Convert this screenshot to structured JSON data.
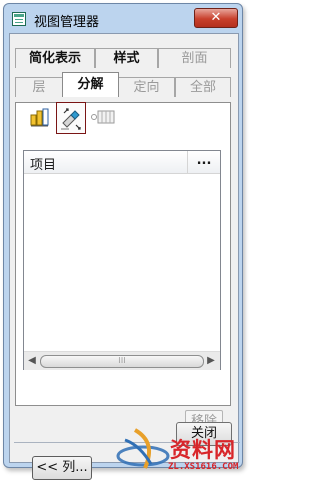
{
  "window": {
    "title": "视图管理器",
    "close_glyph": "✕"
  },
  "tabs": {
    "row1": [
      {
        "label": "简化表示",
        "state": "normal"
      },
      {
        "label": "样式",
        "state": "normal"
      },
      {
        "label": "剖面",
        "state": "disabled"
      }
    ],
    "row2": [
      {
        "label": "层",
        "state": "disabled"
      },
      {
        "label": "分解",
        "state": "active"
      },
      {
        "label": "定向",
        "state": "disabled"
      },
      {
        "label": "全部",
        "state": "disabled"
      }
    ]
  },
  "toolbar": {
    "icons": [
      "explode-state-icon",
      "edit-position-icon",
      "toggle-status-icon"
    ]
  },
  "list": {
    "column_header": "项目",
    "header_menu": "...",
    "scroll_thumb_grip": "⁝⁝⁝",
    "scroll_left": "◀",
    "scroll_right": "▶"
  },
  "buttons": {
    "remove": "移除",
    "columns": "<< 列...",
    "close": "关闭"
  },
  "watermark": {
    "site": "资料网",
    "url": "ZL.XS1616.COM"
  },
  "colors": {
    "title_bar": "#bcd4ee",
    "close_button": "#c8402c",
    "selected_tool_border": "#7a1515",
    "disabled_text": "#9a9a9a",
    "watermark_red": "#d8262a"
  }
}
